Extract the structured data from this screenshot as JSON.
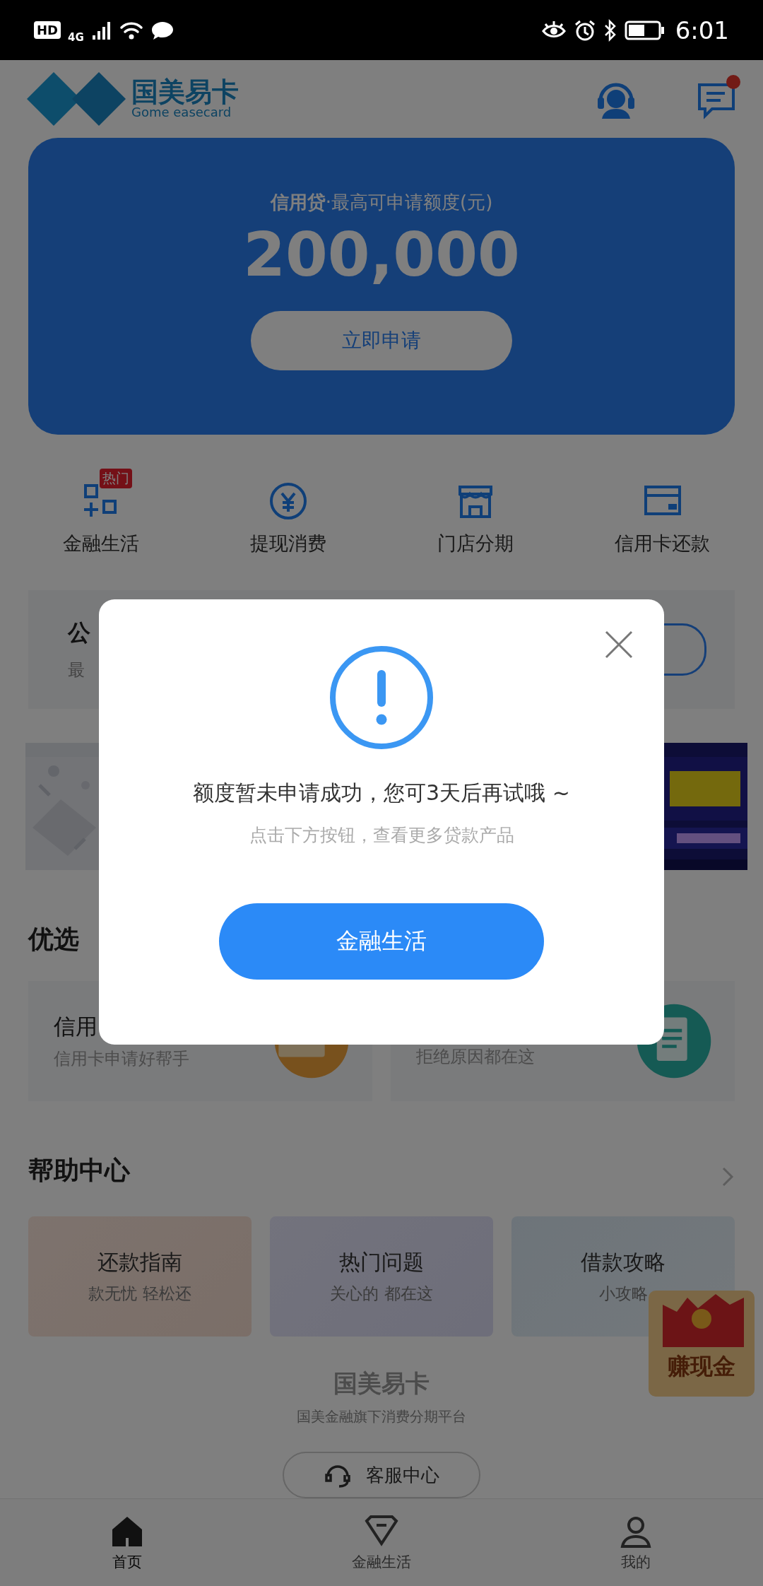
{
  "status_bar": {
    "hd": "HD",
    "network": "4G",
    "time": "6:01"
  },
  "header": {
    "logo_title": "国美易卡",
    "logo_subtitle": "Gome easecard",
    "has_unread": true
  },
  "loan_card": {
    "label_bold": "信用贷",
    "label": "·最高可申请额度(元)",
    "amount": "200,000",
    "button": "立即申请"
  },
  "quick_menu": [
    {
      "label": "金融生活",
      "badge": "热门"
    },
    {
      "label": "提现消费"
    },
    {
      "label": "门店分期"
    },
    {
      "label": "信用卡还款"
    }
  ],
  "notice": {
    "title": "公",
    "subtitle": "最"
  },
  "recommend": {
    "title": "优选",
    "cards": [
      {
        "title": "信用",
        "subtitle": "信用卡申请好帮手"
      },
      {
        "subtitle": "拒绝原因都在这"
      }
    ]
  },
  "help_center": {
    "title": "帮助中心",
    "cards": [
      {
        "title": "还款指南",
        "subtitle": "款无忧 轻松还"
      },
      {
        "title": "热门问题",
        "subtitle": "关心的 都在这"
      },
      {
        "title": "借款攻略",
        "subtitle": "小攻略"
      }
    ]
  },
  "float_badge": "赚现金",
  "footer": {
    "brand": "国美易卡",
    "tagline": "国美金融旗下消费分期平台",
    "button": "客服中心"
  },
  "tab_bar": [
    {
      "label": "首页",
      "selected": true
    },
    {
      "label": "金融生活",
      "selected": false
    },
    {
      "label": "我的",
      "selected": false
    }
  ],
  "dialog": {
    "message": "额度暂未申请成功，您可3天后再试哦 ~",
    "hint": "点击下方按钮，查看更多贷款产品",
    "button": "金融生活"
  }
}
